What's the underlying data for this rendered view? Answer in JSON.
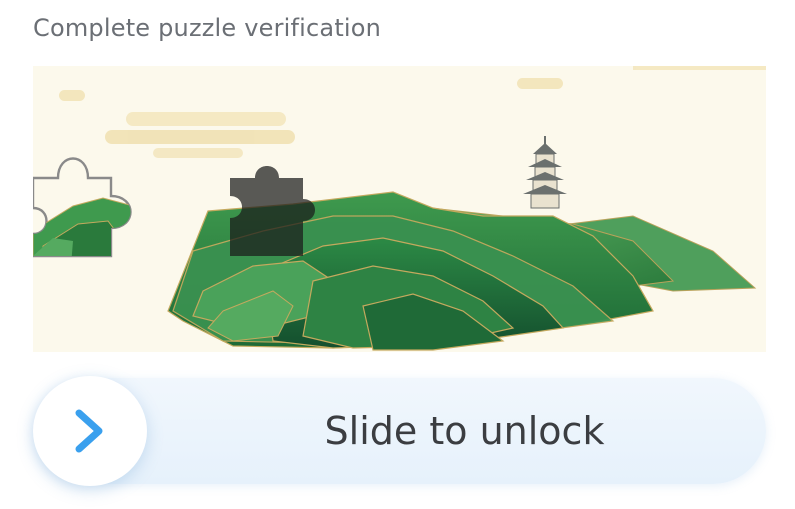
{
  "captcha": {
    "title": "Complete puzzle verification",
    "slider_label": "Slide to unlock",
    "handle_icon": "chevron-right-icon",
    "scene": "landscape with green terraced hills and pagoda"
  },
  "colors": {
    "title_text": "#6b6f75",
    "label_text": "#3b3d41",
    "arrow": "#3aa0ee",
    "track": "#e9f3fc",
    "image_background": "#fcf9ec"
  }
}
